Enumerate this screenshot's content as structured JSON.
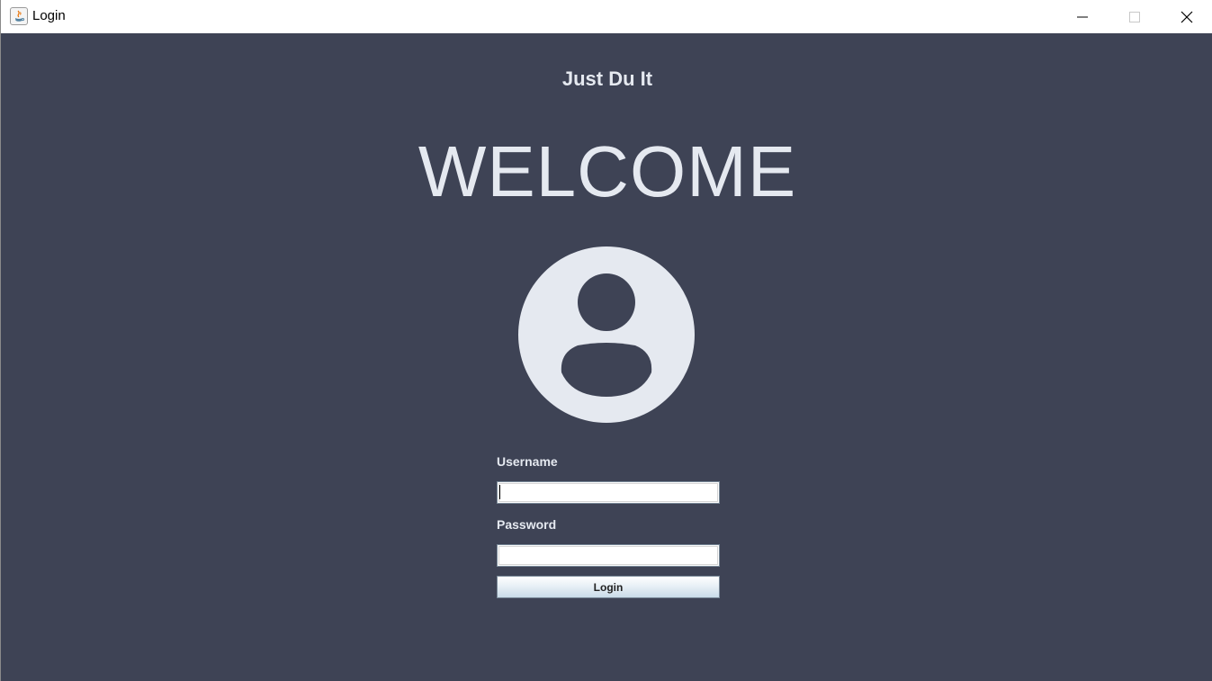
{
  "window": {
    "title": "Login"
  },
  "titlebar_buttons": {
    "minimize_icon": "minimize-icon",
    "maximize_icon": "maximize-icon",
    "close_icon": "close-icon"
  },
  "header": {
    "brand": "Just Du It",
    "welcome": "WELCOME"
  },
  "avatar": {
    "icon": "user-avatar-icon"
  },
  "form": {
    "username_label": "Username",
    "username_value": "",
    "password_label": "Password",
    "password_value": "",
    "login_label": "Login"
  },
  "colors": {
    "background": "#3e4355",
    "foreground": "#e5e9f0",
    "titlebar": "#ffffff"
  }
}
